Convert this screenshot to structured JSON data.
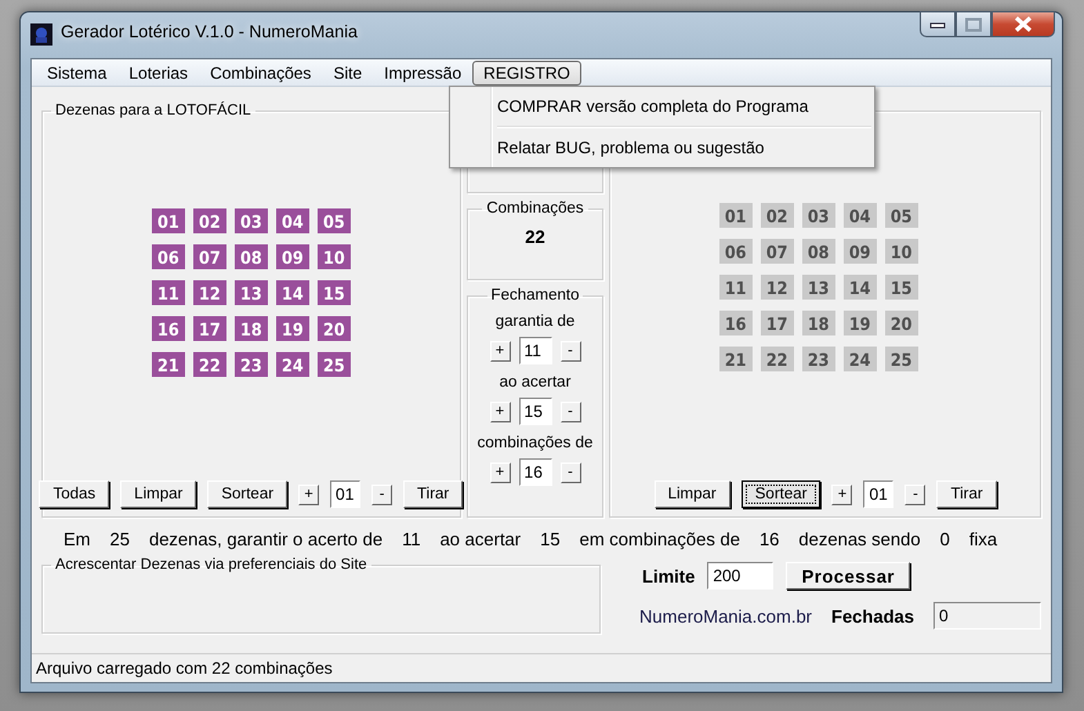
{
  "window": {
    "title": "Gerador Lotérico V.1.0 - NumeroMania"
  },
  "menu": [
    {
      "label": "Sistema",
      "selected": false
    },
    {
      "label": "Loterias",
      "selected": false
    },
    {
      "label": "Combinações",
      "selected": false
    },
    {
      "label": "Site",
      "selected": false
    },
    {
      "label": "Impressão",
      "selected": false
    },
    {
      "label": "REGISTRO",
      "selected": true
    }
  ],
  "dropdown": {
    "items": [
      "COMPRAR versão completa do Programa",
      "Relatar BUG, problema ou sugestão"
    ]
  },
  "left_panel": {
    "title": "Dezenas para a LOTOFÁCIL",
    "numbers": [
      {
        "label": "01",
        "selected": true
      },
      {
        "label": "02",
        "selected": true
      },
      {
        "label": "03",
        "selected": true
      },
      {
        "label": "04",
        "selected": true
      },
      {
        "label": "05",
        "selected": true
      },
      {
        "label": "06",
        "selected": true
      },
      {
        "label": "07",
        "selected": true
      },
      {
        "label": "08",
        "selected": true
      },
      {
        "label": "09",
        "selected": true
      },
      {
        "label": "10",
        "selected": true
      },
      {
        "label": "11",
        "selected": true
      },
      {
        "label": "12",
        "selected": true
      },
      {
        "label": "13",
        "selected": true
      },
      {
        "label": "14",
        "selected": true
      },
      {
        "label": "15",
        "selected": true
      },
      {
        "label": "16",
        "selected": true
      },
      {
        "label": "17",
        "selected": true
      },
      {
        "label": "18",
        "selected": true
      },
      {
        "label": "19",
        "selected": true
      },
      {
        "label": "20",
        "selected": true
      },
      {
        "label": "21",
        "selected": true
      },
      {
        "label": "22",
        "selected": true
      },
      {
        "label": "23",
        "selected": true
      },
      {
        "label": "24",
        "selected": true
      },
      {
        "label": "25",
        "selected": true
      }
    ],
    "controls": [
      {
        "kind": "button",
        "label": "Todas",
        "focused": false
      },
      {
        "kind": "button",
        "label": "Limpar",
        "focused": false
      },
      {
        "kind": "button",
        "label": "Sortear",
        "focused": false
      },
      {
        "kind": "small",
        "label": "+"
      },
      {
        "kind": "field",
        "label": "01"
      },
      {
        "kind": "small",
        "label": "-"
      },
      {
        "kind": "button",
        "label": "Tirar",
        "focused": false
      }
    ]
  },
  "middle": {
    "combinacoes": {
      "title": "Combinações",
      "value": "22"
    },
    "fechamento": {
      "title": "Fechamento",
      "rows": [
        {
          "label": "garantia de",
          "plus": "+",
          "value": "11",
          "minus": "-"
        },
        {
          "label": "ao acertar",
          "plus": "+",
          "value": "15",
          "minus": "-"
        },
        {
          "label": "combinações de",
          "plus": "+",
          "value": "16",
          "minus": "-"
        }
      ]
    }
  },
  "right_panel": {
    "numbers": [
      {
        "label": "01",
        "selected": false
      },
      {
        "label": "02",
        "selected": false
      },
      {
        "label": "03",
        "selected": false
      },
      {
        "label": "04",
        "selected": false
      },
      {
        "label": "05",
        "selected": false
      },
      {
        "label": "06",
        "selected": false
      },
      {
        "label": "07",
        "selected": false
      },
      {
        "label": "08",
        "selected": false
      },
      {
        "label": "09",
        "selected": false
      },
      {
        "label": "10",
        "selected": false
      },
      {
        "label": "11",
        "selected": false
      },
      {
        "label": "12",
        "selected": false
      },
      {
        "label": "13",
        "selected": false
      },
      {
        "label": "14",
        "selected": false
      },
      {
        "label": "15",
        "selected": false
      },
      {
        "label": "16",
        "selected": false
      },
      {
        "label": "17",
        "selected": false
      },
      {
        "label": "18",
        "selected": false
      },
      {
        "label": "19",
        "selected": false
      },
      {
        "label": "20",
        "selected": false
      },
      {
        "label": "21",
        "selected": false
      },
      {
        "label": "22",
        "selected": false
      },
      {
        "label": "23",
        "selected": false
      },
      {
        "label": "24",
        "selected": false
      },
      {
        "label": "25",
        "selected": false
      }
    ],
    "controls": [
      {
        "kind": "button",
        "label": "Limpar",
        "focused": false
      },
      {
        "kind": "button",
        "label": "Sortear",
        "focused": true
      },
      {
        "kind": "small",
        "label": "+"
      },
      {
        "kind": "field",
        "label": "01"
      },
      {
        "kind": "small",
        "label": "-"
      },
      {
        "kind": "button",
        "label": "Tirar",
        "focused": false
      }
    ]
  },
  "summary": [
    "Em",
    "25",
    "dezenas, garantir o acerto de",
    "11",
    "ao acertar",
    "15",
    "em combinações de",
    "16",
    "dezenas sendo",
    "0",
    "fixa"
  ],
  "preferenciais": {
    "title": "Acrescentar Dezenas via preferenciais do Site"
  },
  "limite": {
    "label": "Limite",
    "value": "200"
  },
  "process_button": "Processar",
  "site": "NumeroMania.com.br",
  "fechadas": {
    "label": "Fechadas",
    "value": "0"
  },
  "status_bar": "Arquivo carregado com 22 combinações"
}
